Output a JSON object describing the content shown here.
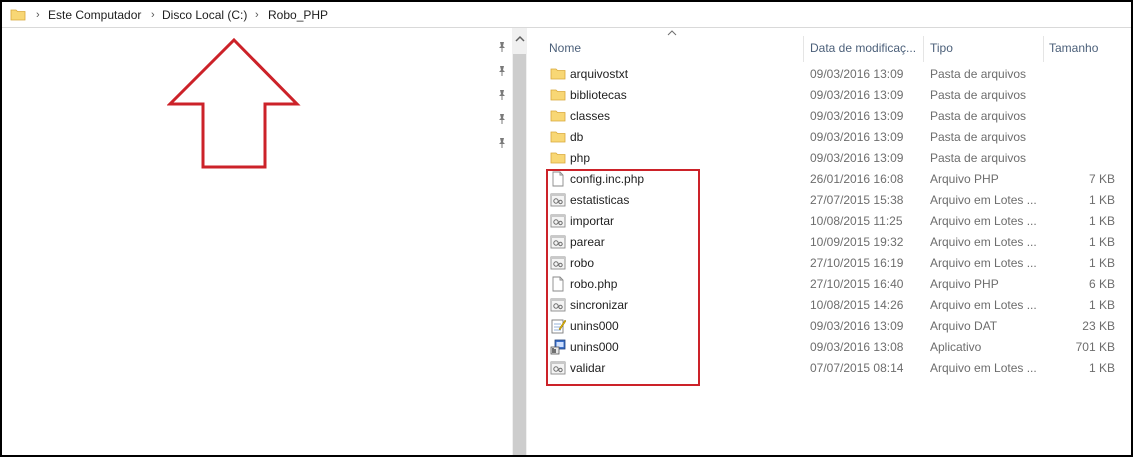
{
  "breadcrumb": {
    "items": [
      "Este Computador",
      "Disco Local (C:)",
      "Robo_PHP"
    ],
    "separator": "›",
    "folder_icon": "folder-icon"
  },
  "navigation_pane": {
    "pinned_icons": [
      "pin-icon",
      "pin-icon",
      "pin-icon",
      "pin-icon",
      "pin-icon"
    ],
    "scroll_up_icon": "chevron-up-icon"
  },
  "annotation": {
    "arrow_icon": "up-arrow-outline-icon",
    "arrow_color": "#cc2229",
    "highlight_color": "#cc2229"
  },
  "columns": {
    "name": "Nome",
    "date": "Data de modificaç...",
    "type": "Tipo",
    "size": "Tamanho",
    "sort_icon": "chevron-up-icon"
  },
  "files": [
    {
      "name": "arquivostxt",
      "date": "09/03/2016 13:09",
      "type": "Pasta de arquivos",
      "size": "",
      "icon": "folder-icon"
    },
    {
      "name": "bibliotecas",
      "date": "09/03/2016 13:09",
      "type": "Pasta de arquivos",
      "size": "",
      "icon": "folder-icon"
    },
    {
      "name": "classes",
      "date": "09/03/2016 13:09",
      "type": "Pasta de arquivos",
      "size": "",
      "icon": "folder-icon"
    },
    {
      "name": "db",
      "date": "09/03/2016 13:09",
      "type": "Pasta de arquivos",
      "size": "",
      "icon": "folder-icon"
    },
    {
      "name": "php",
      "date": "09/03/2016 13:09",
      "type": "Pasta de arquivos",
      "size": "",
      "icon": "folder-icon"
    },
    {
      "name": "config.inc.php",
      "date": "26/01/2016 16:08",
      "type": "Arquivo PHP",
      "size": "7 KB",
      "icon": "blank-file-icon"
    },
    {
      "name": "estatisticas",
      "date": "27/07/2015 15:38",
      "type": "Arquivo em Lotes ...",
      "size": "1 KB",
      "icon": "batch-file-icon"
    },
    {
      "name": "importar",
      "date": "10/08/2015 11:25",
      "type": "Arquivo em Lotes ...",
      "size": "1 KB",
      "icon": "batch-file-icon"
    },
    {
      "name": "parear",
      "date": "10/09/2015 19:32",
      "type": "Arquivo em Lotes ...",
      "size": "1 KB",
      "icon": "batch-file-icon"
    },
    {
      "name": "robo",
      "date": "27/10/2015 16:19",
      "type": "Arquivo em Lotes ...",
      "size": "1 KB",
      "icon": "batch-file-icon"
    },
    {
      "name": "robo.php",
      "date": "27/10/2015 16:40",
      "type": "Arquivo PHP",
      "size": "6 KB",
      "icon": "blank-file-icon"
    },
    {
      "name": "sincronizar",
      "date": "10/08/2015 14:26",
      "type": "Arquivo em Lotes ...",
      "size": "1 KB",
      "icon": "batch-file-icon"
    },
    {
      "name": "unins000",
      "date": "09/03/2016 13:09",
      "type": "Arquivo DAT",
      "size": "23 KB",
      "icon": "notepad-file-icon"
    },
    {
      "name": "unins000",
      "date": "09/03/2016 13:08",
      "type": "Aplicativo",
      "size": "701 KB",
      "icon": "installer-app-icon"
    },
    {
      "name": "validar",
      "date": "07/07/2015 08:14",
      "type": "Arquivo em Lotes ...",
      "size": "1 KB",
      "icon": "batch-file-icon"
    }
  ]
}
